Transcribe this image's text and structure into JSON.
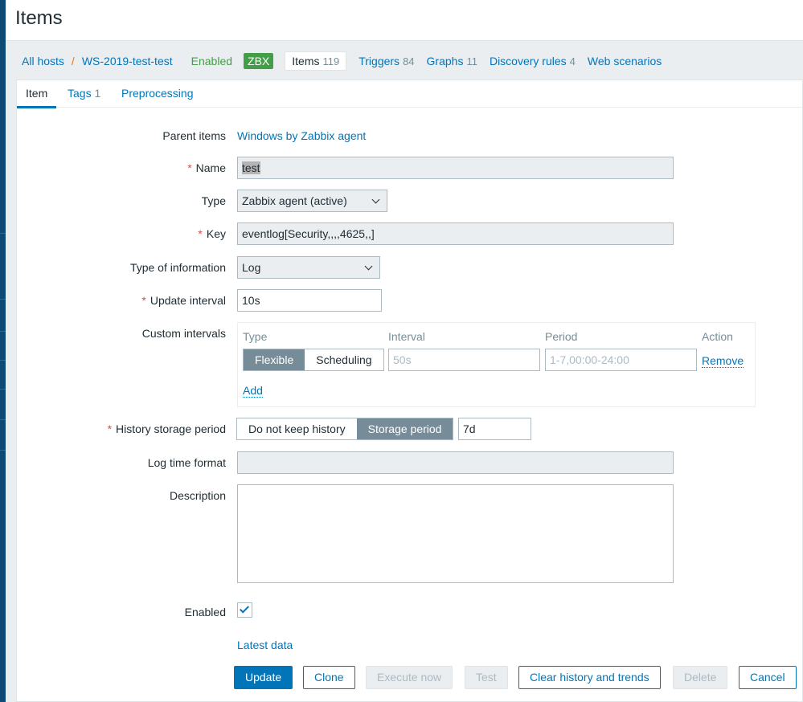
{
  "page_title": "Items",
  "nav": {
    "all_hosts": "All hosts",
    "host": "WS-2019-test-test",
    "status": "Enabled",
    "zbx": "ZBX",
    "items": "Items",
    "items_count": "119",
    "triggers": "Triggers",
    "triggers_count": "84",
    "graphs": "Graphs",
    "graphs_count": "11",
    "discovery": "Discovery rules",
    "discovery_count": "4",
    "web": "Web scenarios"
  },
  "tabs": {
    "item": "Item",
    "tags": "Tags",
    "tags_count": "1",
    "preprocessing": "Preprocessing"
  },
  "form": {
    "parent_label": "Parent items",
    "parent_value": "Windows by Zabbix agent",
    "name_label": "Name",
    "name_value": "test",
    "type_label": "Type",
    "type_value": "Zabbix agent (active)",
    "key_label": "Key",
    "key_value": "eventlog[Security,,,,4625,,]",
    "toi_label": "Type of information",
    "toi_value": "Log",
    "interval_label": "Update interval",
    "interval_value": "10s",
    "custom_label": "Custom intervals",
    "custom": {
      "col_type": "Type",
      "col_interval": "Interval",
      "col_period": "Period",
      "col_action": "Action",
      "flexible": "Flexible",
      "scheduling": "Scheduling",
      "interval_placeholder": "50s",
      "period_placeholder": "1-7,00:00-24:00",
      "remove": "Remove",
      "add": "Add"
    },
    "history_label": "History storage period",
    "history_no": "Do not keep history",
    "history_storage": "Storage period",
    "history_value": "7d",
    "logtime_label": "Log time format",
    "logtime_value": "",
    "desc_label": "Description",
    "desc_value": "",
    "enabled_label": "Enabled",
    "enabled": true,
    "latest": "Latest data"
  },
  "buttons": {
    "update": "Update",
    "clone": "Clone",
    "execute": "Execute now",
    "test": "Test",
    "clear": "Clear history and trends",
    "delete": "Delete",
    "cancel": "Cancel"
  }
}
